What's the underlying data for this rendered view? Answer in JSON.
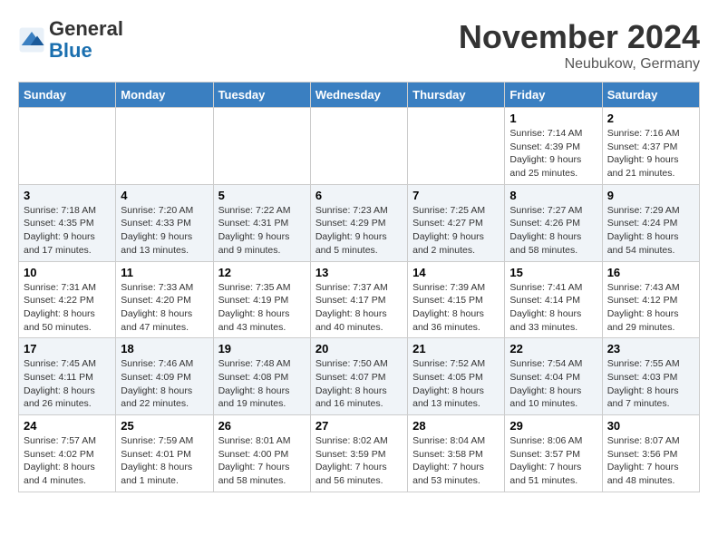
{
  "header": {
    "logo_general": "General",
    "logo_blue": "Blue",
    "month_title": "November 2024",
    "location": "Neubukow, Germany"
  },
  "columns": [
    "Sunday",
    "Monday",
    "Tuesday",
    "Wednesday",
    "Thursday",
    "Friday",
    "Saturday"
  ],
  "weeks": [
    [
      {
        "day": "",
        "info": ""
      },
      {
        "day": "",
        "info": ""
      },
      {
        "day": "",
        "info": ""
      },
      {
        "day": "",
        "info": ""
      },
      {
        "day": "",
        "info": ""
      },
      {
        "day": "1",
        "info": "Sunrise: 7:14 AM\nSunset: 4:39 PM\nDaylight: 9 hours\nand 25 minutes."
      },
      {
        "day": "2",
        "info": "Sunrise: 7:16 AM\nSunset: 4:37 PM\nDaylight: 9 hours\nand 21 minutes."
      }
    ],
    [
      {
        "day": "3",
        "info": "Sunrise: 7:18 AM\nSunset: 4:35 PM\nDaylight: 9 hours\nand 17 minutes."
      },
      {
        "day": "4",
        "info": "Sunrise: 7:20 AM\nSunset: 4:33 PM\nDaylight: 9 hours\nand 13 minutes."
      },
      {
        "day": "5",
        "info": "Sunrise: 7:22 AM\nSunset: 4:31 PM\nDaylight: 9 hours\nand 9 minutes."
      },
      {
        "day": "6",
        "info": "Sunrise: 7:23 AM\nSunset: 4:29 PM\nDaylight: 9 hours\nand 5 minutes."
      },
      {
        "day": "7",
        "info": "Sunrise: 7:25 AM\nSunset: 4:27 PM\nDaylight: 9 hours\nand 2 minutes."
      },
      {
        "day": "8",
        "info": "Sunrise: 7:27 AM\nSunset: 4:26 PM\nDaylight: 8 hours\nand 58 minutes."
      },
      {
        "day": "9",
        "info": "Sunrise: 7:29 AM\nSunset: 4:24 PM\nDaylight: 8 hours\nand 54 minutes."
      }
    ],
    [
      {
        "day": "10",
        "info": "Sunrise: 7:31 AM\nSunset: 4:22 PM\nDaylight: 8 hours\nand 50 minutes."
      },
      {
        "day": "11",
        "info": "Sunrise: 7:33 AM\nSunset: 4:20 PM\nDaylight: 8 hours\nand 47 minutes."
      },
      {
        "day": "12",
        "info": "Sunrise: 7:35 AM\nSunset: 4:19 PM\nDaylight: 8 hours\nand 43 minutes."
      },
      {
        "day": "13",
        "info": "Sunrise: 7:37 AM\nSunset: 4:17 PM\nDaylight: 8 hours\nand 40 minutes."
      },
      {
        "day": "14",
        "info": "Sunrise: 7:39 AM\nSunset: 4:15 PM\nDaylight: 8 hours\nand 36 minutes."
      },
      {
        "day": "15",
        "info": "Sunrise: 7:41 AM\nSunset: 4:14 PM\nDaylight: 8 hours\nand 33 minutes."
      },
      {
        "day": "16",
        "info": "Sunrise: 7:43 AM\nSunset: 4:12 PM\nDaylight: 8 hours\nand 29 minutes."
      }
    ],
    [
      {
        "day": "17",
        "info": "Sunrise: 7:45 AM\nSunset: 4:11 PM\nDaylight: 8 hours\nand 26 minutes."
      },
      {
        "day": "18",
        "info": "Sunrise: 7:46 AM\nSunset: 4:09 PM\nDaylight: 8 hours\nand 22 minutes."
      },
      {
        "day": "19",
        "info": "Sunrise: 7:48 AM\nSunset: 4:08 PM\nDaylight: 8 hours\nand 19 minutes."
      },
      {
        "day": "20",
        "info": "Sunrise: 7:50 AM\nSunset: 4:07 PM\nDaylight: 8 hours\nand 16 minutes."
      },
      {
        "day": "21",
        "info": "Sunrise: 7:52 AM\nSunset: 4:05 PM\nDaylight: 8 hours\nand 13 minutes."
      },
      {
        "day": "22",
        "info": "Sunrise: 7:54 AM\nSunset: 4:04 PM\nDaylight: 8 hours\nand 10 minutes."
      },
      {
        "day": "23",
        "info": "Sunrise: 7:55 AM\nSunset: 4:03 PM\nDaylight: 8 hours\nand 7 minutes."
      }
    ],
    [
      {
        "day": "24",
        "info": "Sunrise: 7:57 AM\nSunset: 4:02 PM\nDaylight: 8 hours\nand 4 minutes."
      },
      {
        "day": "25",
        "info": "Sunrise: 7:59 AM\nSunset: 4:01 PM\nDaylight: 8 hours\nand 1 minute."
      },
      {
        "day": "26",
        "info": "Sunrise: 8:01 AM\nSunset: 4:00 PM\nDaylight: 7 hours\nand 58 minutes."
      },
      {
        "day": "27",
        "info": "Sunrise: 8:02 AM\nSunset: 3:59 PM\nDaylight: 7 hours\nand 56 minutes."
      },
      {
        "day": "28",
        "info": "Sunrise: 8:04 AM\nSunset: 3:58 PM\nDaylight: 7 hours\nand 53 minutes."
      },
      {
        "day": "29",
        "info": "Sunrise: 8:06 AM\nSunset: 3:57 PM\nDaylight: 7 hours\nand 51 minutes."
      },
      {
        "day": "30",
        "info": "Sunrise: 8:07 AM\nSunset: 3:56 PM\nDaylight: 7 hours\nand 48 minutes."
      }
    ]
  ]
}
